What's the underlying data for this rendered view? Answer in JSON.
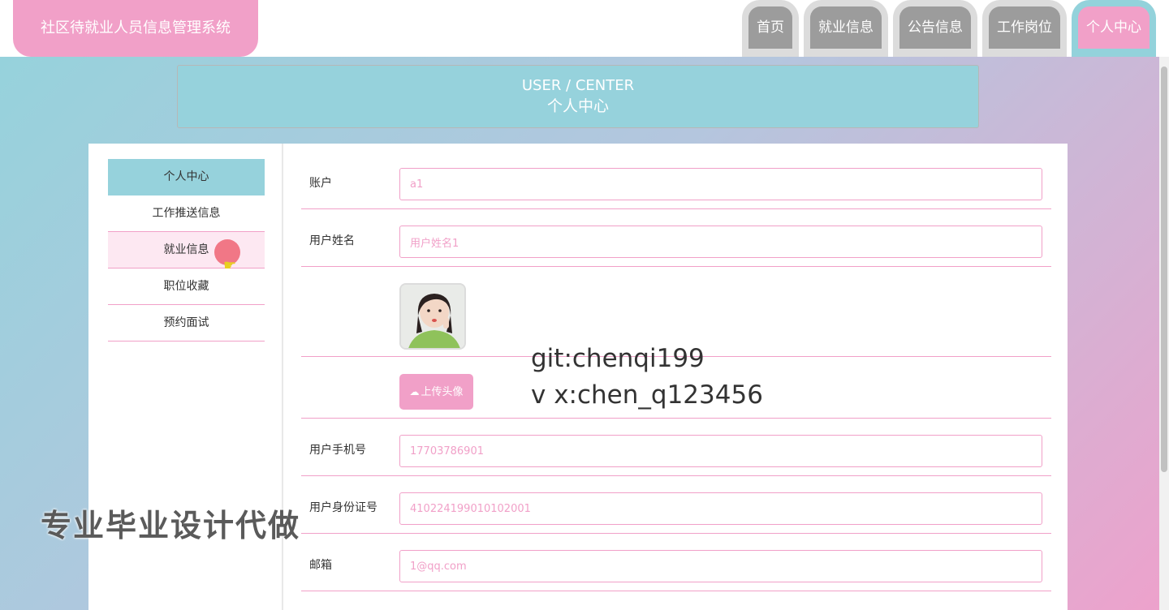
{
  "app": {
    "title": "社区待就业人员信息管理系统"
  },
  "nav": [
    {
      "label": "首页"
    },
    {
      "label": "就业信息"
    },
    {
      "label": "公告信息"
    },
    {
      "label": "工作岗位"
    },
    {
      "label": "个人中心"
    }
  ],
  "banner": {
    "en": "USER / CENTER",
    "cn": "个人中心"
  },
  "sidebar": {
    "items": [
      {
        "label": "个人中心"
      },
      {
        "label": "工作推送信息"
      },
      {
        "label": "就业信息"
      },
      {
        "label": "职位收藏"
      },
      {
        "label": "预约面试"
      }
    ]
  },
  "form": {
    "account_label": "账户",
    "account_value": "a1",
    "name_label": "用户姓名",
    "name_value": "用户姓名1",
    "upload_label": "上传头像",
    "phone_label": "用户手机号",
    "phone_value": "17703786901",
    "idcard_label": "用户身份证号",
    "idcard_value": "410224199010102001",
    "email_label": "邮箱",
    "email_value": "1@qq.com"
  },
  "watermark": {
    "line1": "git:chenqi199",
    "line2": "v x:chen_q123456"
  },
  "overlay": {
    "text": "专业毕业设计代做"
  },
  "colors": {
    "pink": "#f1a0c8",
    "teal": "#96d2dc",
    "nav_gray": "#9c9c9c"
  }
}
